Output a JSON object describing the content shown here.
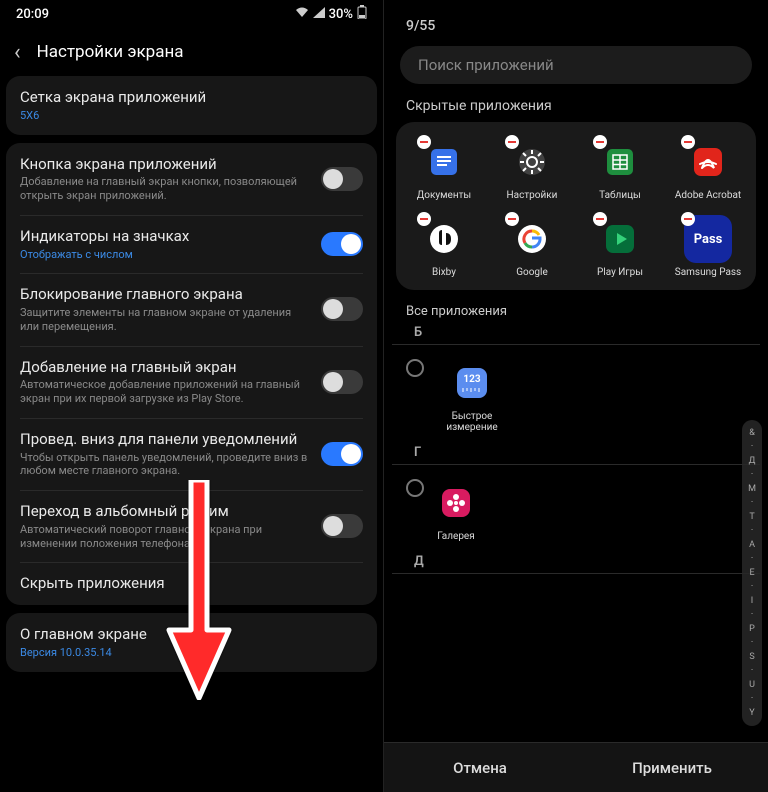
{
  "status": {
    "time": "20:09",
    "battery": "30%"
  },
  "left": {
    "title": "Настройки экрана",
    "card1": {
      "grid_title": "Сетка экрана приложений",
      "grid_value": "5X6"
    },
    "rows": [
      {
        "title": "Кнопка экрана приложений",
        "sub": "Добавление на главный экран кнопки, позволяющей открыть экран приложений.",
        "on": false
      },
      {
        "title": "Индикаторы на значках",
        "sub": "Отображать с числом",
        "subBlue": true,
        "on": true
      },
      {
        "title": "Блокирование главного экрана",
        "sub": "Защитите элементы на главном экране от удаления или перемещения.",
        "on": false
      },
      {
        "title": "Добавление на главный экран",
        "sub": "Автоматическое добавление приложений на главный экран при их первой загрузке из Play Store.",
        "on": false
      },
      {
        "title": "Провед. вниз для панели уведомлений",
        "sub": "Чтобы открыть панель уведомлений, проведите вниз в любом месте главного экрана.",
        "on": true
      },
      {
        "title": "Переход в альбомный режим",
        "sub": "Автоматический поворот главного экрана при изменении положения телефона.",
        "on": false
      }
    ],
    "hide_row": "Скрыть приложения",
    "about": {
      "title": "О главном экране",
      "version": "Версия 10.0.35.14"
    }
  },
  "right": {
    "counter": "9/55",
    "search_placeholder": "Поиск приложений",
    "hidden_label": "Скрытые приложения",
    "hidden_apps": [
      {
        "name": "Документы",
        "icon": "docs"
      },
      {
        "name": "Настройки",
        "icon": "settings"
      },
      {
        "name": "Таблицы",
        "icon": "sheets"
      },
      {
        "name": "Adobe Acrobat",
        "icon": "acrobat"
      },
      {
        "name": "Bixby",
        "icon": "bixby"
      },
      {
        "name": "Google",
        "icon": "google"
      },
      {
        "name": "Play Игры",
        "icon": "play"
      },
      {
        "name": "Samsung Pass",
        "icon": "pass"
      }
    ],
    "all_label": "Все приложения",
    "groups": [
      {
        "letter": "Б",
        "apps": [
          {
            "name": "Быстрое измерение",
            "icon": "measure"
          }
        ]
      },
      {
        "letter": "Г",
        "apps": [
          {
            "name": "Галерея",
            "icon": "gallery"
          }
        ]
      },
      {
        "letter": "Д",
        "apps": []
      }
    ],
    "index": [
      "&",
      "·",
      "Д",
      "·",
      "М",
      "·",
      "Т",
      "·",
      "А",
      "·",
      "Е",
      "·",
      "I",
      "·",
      "Р",
      "·",
      "S",
      "·",
      "U",
      "·",
      "Y"
    ],
    "cancel": "Отмена",
    "apply": "Применить"
  }
}
